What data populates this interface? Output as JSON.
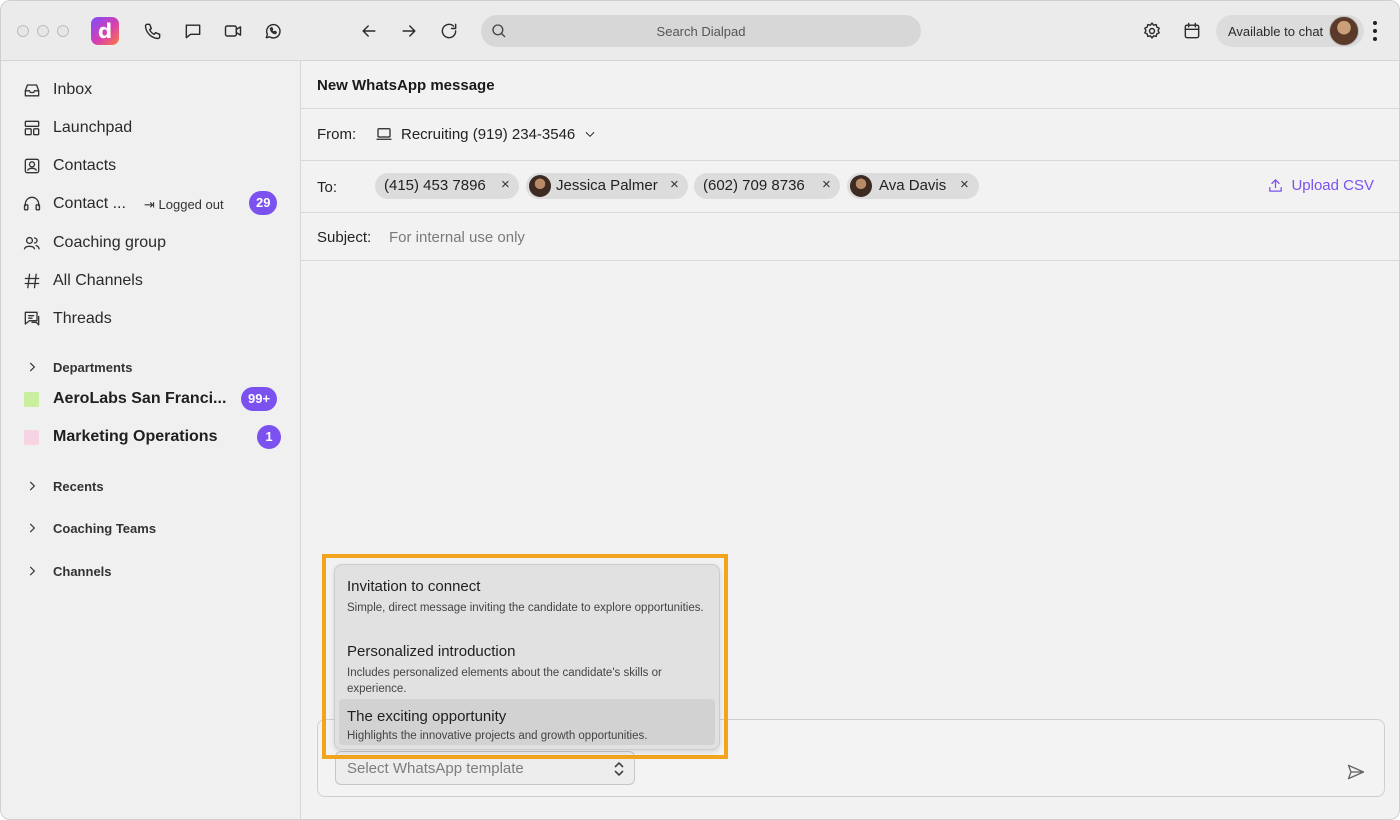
{
  "app": {
    "name": "Dialpad",
    "logo_letter": "d"
  },
  "search": {
    "placeholder": "Search Dialpad"
  },
  "status": {
    "label": "Available to chat"
  },
  "sidebar": {
    "items": [
      {
        "label": "Inbox",
        "icon": "inbox-icon"
      },
      {
        "label": "Launchpad",
        "icon": "launchpad-icon"
      },
      {
        "label": "Contacts",
        "icon": "contacts-icon"
      },
      {
        "label": "Contact ...",
        "icon": "headset-icon",
        "note": "Logged out",
        "badge": "29"
      },
      {
        "label": "Coaching group",
        "icon": "people-icon"
      },
      {
        "label": "All Channels",
        "icon": "hash-icon"
      },
      {
        "label": "Threads",
        "icon": "threads-icon"
      }
    ],
    "sections": {
      "departments": "Departments",
      "recents": "Recents",
      "coaching_teams": "Coaching Teams",
      "channels": "Channels"
    },
    "departments": [
      {
        "label": "AeroLabs San Franci...",
        "badge": "99+",
        "color": "#c9ef9e"
      },
      {
        "label": "Marketing Operations",
        "badge": "1",
        "color": "#f6d4e4"
      }
    ]
  },
  "compose": {
    "title": "New WhatsApp message",
    "from_label": "From:",
    "from_value": "Recruiting (919) 234-3546",
    "to_label": "To:",
    "recipients": [
      {
        "label": "(415) 453 7896",
        "avatar": false
      },
      {
        "label": "Jessica Palmer",
        "avatar": true
      },
      {
        "label": "(602) 709 8736",
        "avatar": false
      },
      {
        "label": "Ava Davis",
        "avatar": true
      }
    ],
    "remove_glyph": "×",
    "upload_label": "Upload CSV",
    "subject_label": "Subject:",
    "subject_value": "For internal use only",
    "template_placeholder": "Select WhatsApp template"
  },
  "templates": [
    {
      "title": "Invitation to connect",
      "description": "Simple, direct message inviting the candidate to explore opportunities."
    },
    {
      "title": "Personalized introduction",
      "description": "Includes personalized elements about the candidate's skills or experience."
    },
    {
      "title": "The exciting opportunity",
      "description": "Highlights the innovative projects and growth opportunities.",
      "active": true
    }
  ],
  "colors": {
    "accent": "#7b52f0",
    "highlight": "#f2a41c"
  }
}
